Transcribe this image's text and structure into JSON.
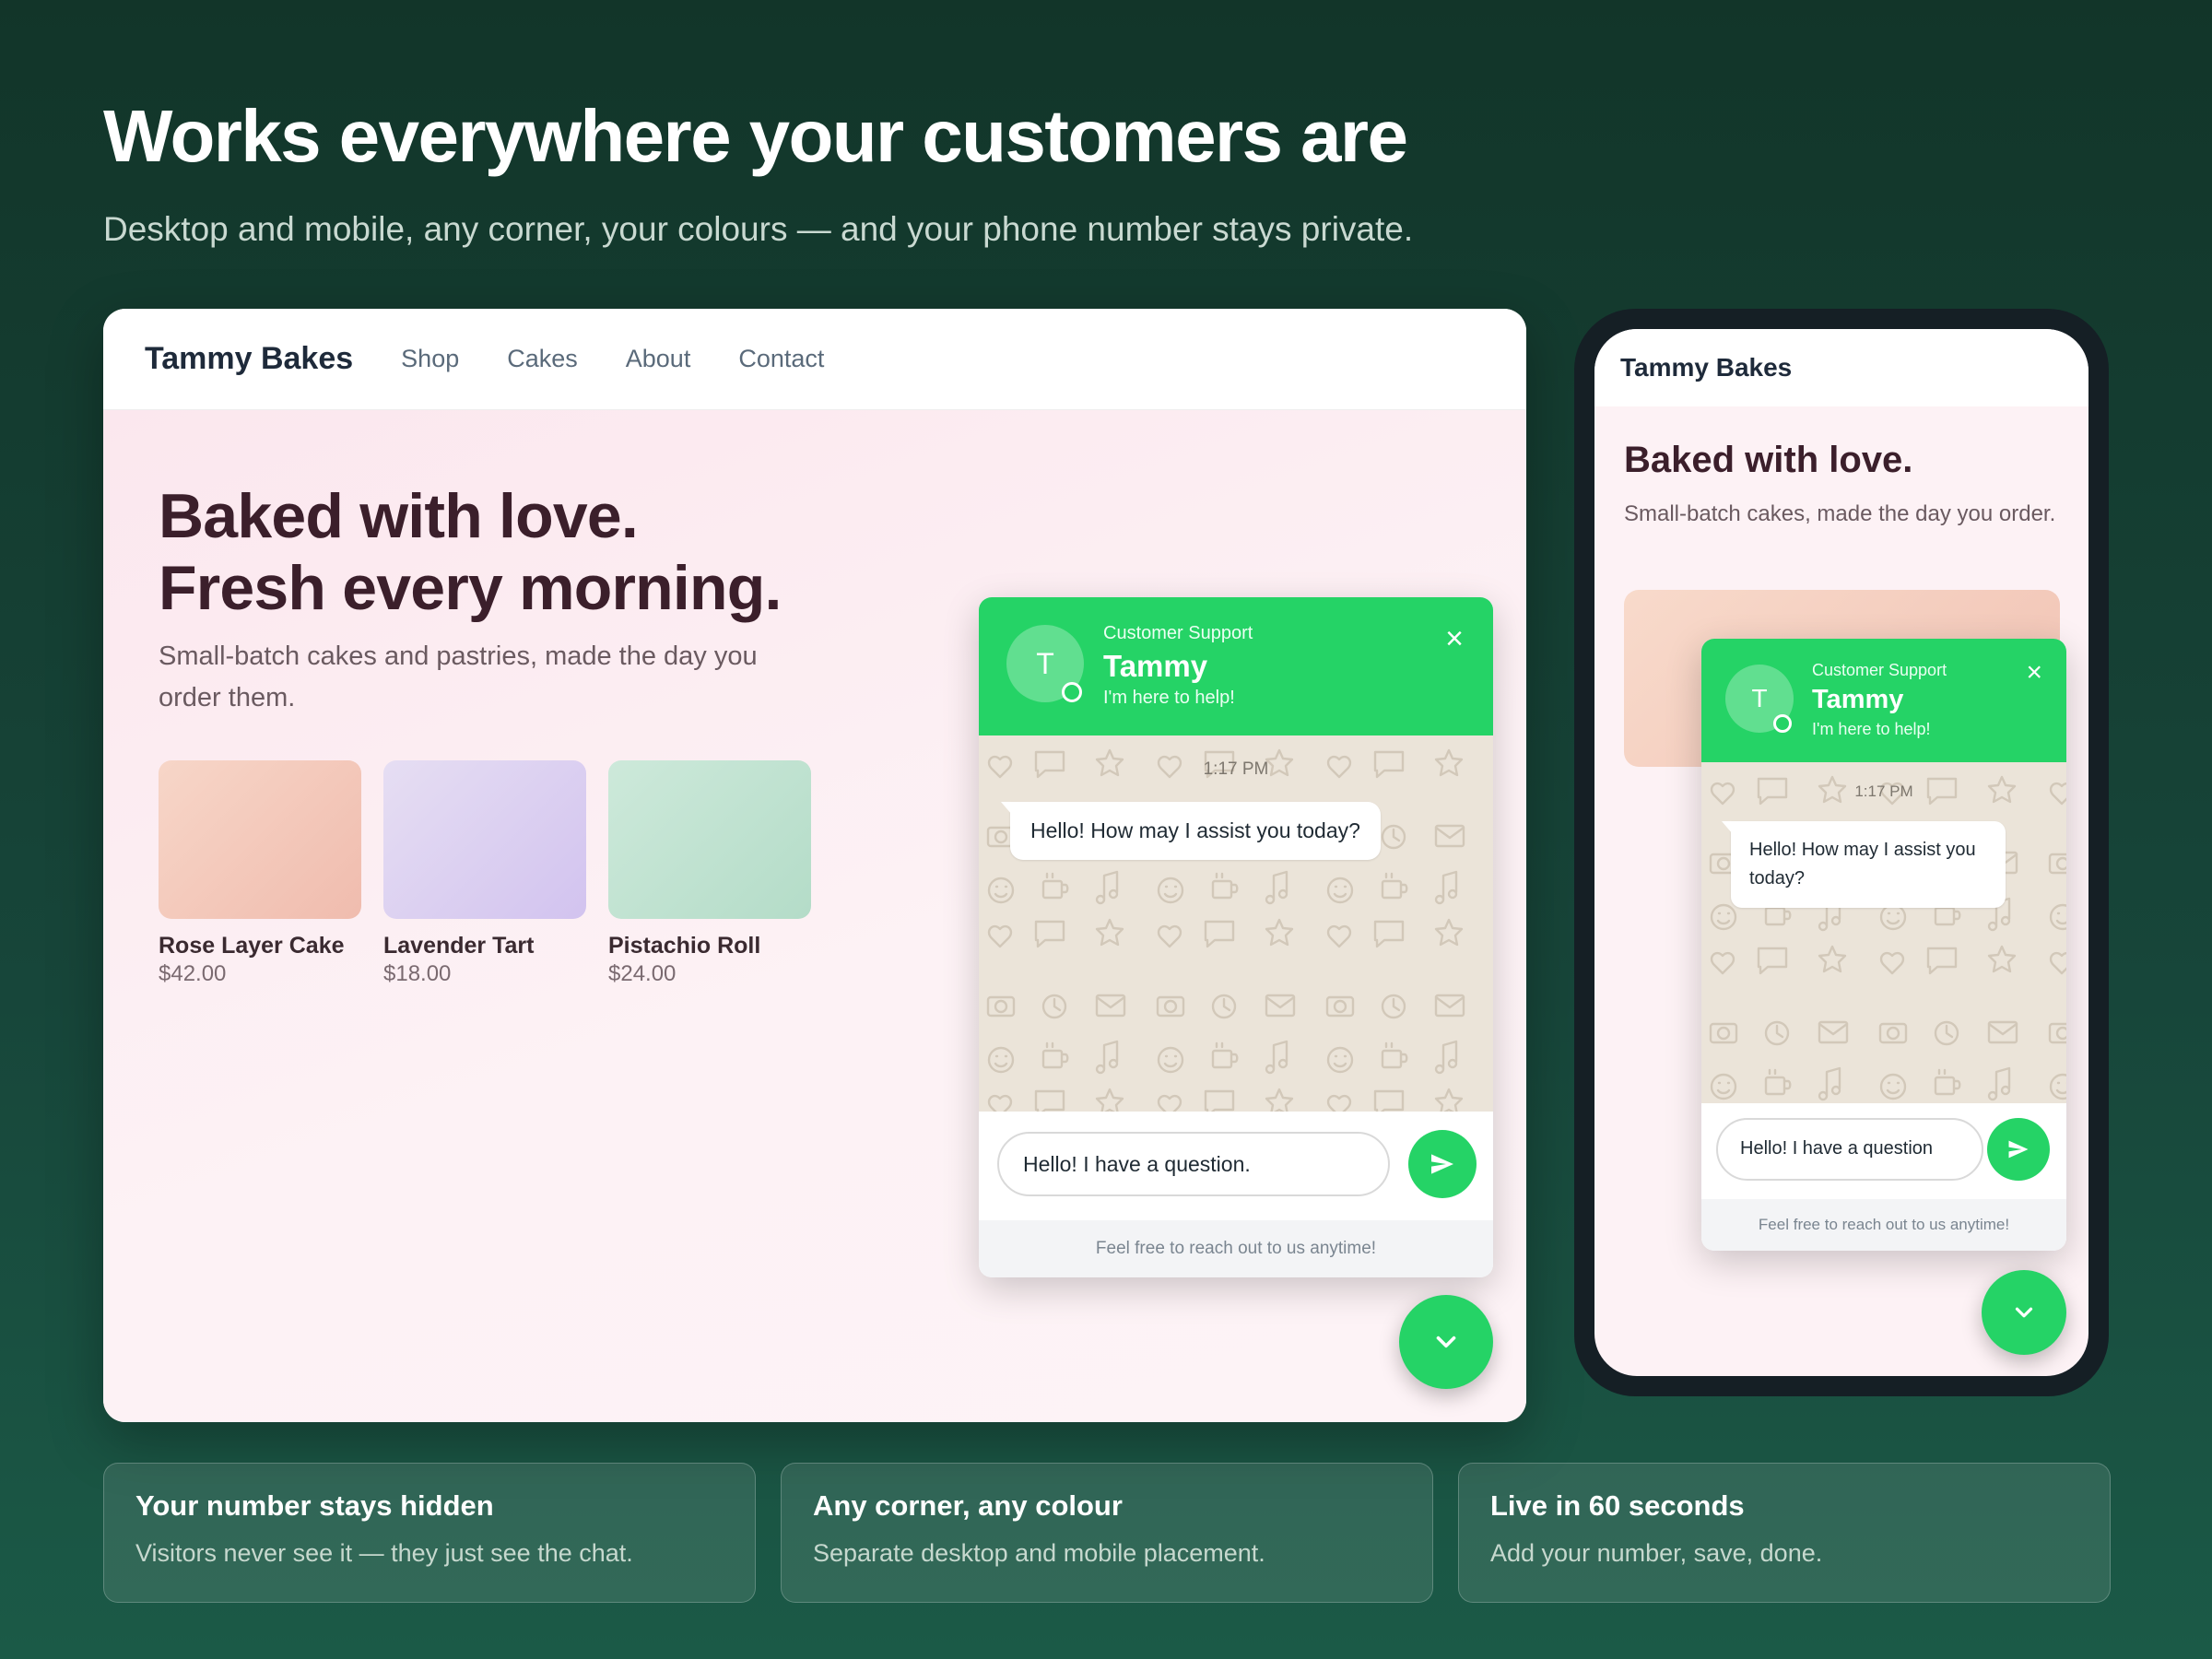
{
  "header": {
    "title": "Works everywhere your customers are",
    "subtitle": "Desktop and mobile, any corner, your colours — and your phone number stays private."
  },
  "site": {
    "brand": "Tammy Bakes",
    "nav": [
      "Shop",
      "Cakes",
      "About",
      "Contact"
    ],
    "hero_line1": "Baked with love.",
    "hero_line2": "Fresh every morning.",
    "hero_sub": "Small-batch cakes and pastries, made the day you order them.",
    "products": [
      {
        "name": "Rose Layer Cake",
        "price": "$42.00",
        "c1": "#f7d6c8",
        "c2": "#f0bcae"
      },
      {
        "name": "Lavender Tart",
        "price": "$18.00",
        "c1": "#e6def3",
        "c2": "#d2c3ef"
      },
      {
        "name": "Pistachio Roll",
        "price": "$24.00",
        "c1": "#cde9da",
        "c2": "#b4dcc8"
      }
    ]
  },
  "chat": {
    "label": "Customer Support",
    "avatar": "T",
    "name": "Tammy",
    "tagline": "I'm here to help!",
    "close_icon": "×",
    "time": "1:17 PM",
    "message": "Hello! How may I assist you today?",
    "input_desktop": "Hello! I have a question.",
    "input_mobile": "Hello! I have a question",
    "footer": "Feel free to reach out to us anytime!",
    "accent": "#25d366"
  },
  "mobile": {
    "brand": "Tammy Bakes",
    "hero": "Baked with love.",
    "sub": "Small-batch cakes, made the day you order."
  },
  "features": [
    {
      "title": "Your number stays hidden",
      "desc": "Visitors never see it — they just see the chat."
    },
    {
      "title": "Any corner, any colour",
      "desc": "Separate desktop and mobile placement."
    },
    {
      "title": "Live in 60 seconds",
      "desc": "Add your number, save, done."
    }
  ]
}
